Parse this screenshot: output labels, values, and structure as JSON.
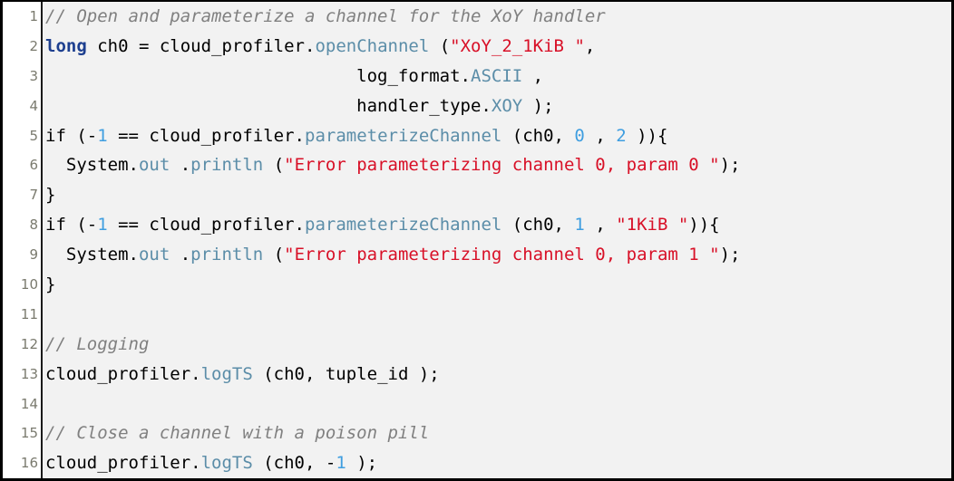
{
  "editor": {
    "kind": "code-listing",
    "language": "java",
    "background": "#f2f2f2",
    "gutter_background": "#ffffff",
    "border_color": "#000000",
    "line_number_color": "#7a7a6e",
    "colors": {
      "comment": "#808080",
      "keyword": "#1d3f8f",
      "method": "#5b8da8",
      "string": "#d81027",
      "number": "#3f9ee0",
      "plain": "#000000"
    },
    "line_numbers": [
      "1",
      "2",
      "3",
      "4",
      "5",
      "6",
      "7",
      "8",
      "9",
      "10",
      "11",
      "12",
      "13",
      "14",
      "15",
      "16"
    ],
    "lines": [
      {
        "number": "1",
        "text": "// Open and parameterize a channel for the XoY handler",
        "tokens": [
          {
            "t": "comment",
            "s": "// Open and parameterize a channel for the XoY handler"
          }
        ]
      },
      {
        "number": "2",
        "text": "long ch0 = cloud_profiler.openChannel (\"XoY_2_1KiB \",",
        "tokens": [
          {
            "t": "keyword",
            "s": "long"
          },
          {
            "t": "plain",
            "s": " ch0 = cloud_profiler."
          },
          {
            "t": "method",
            "s": "openChannel"
          },
          {
            "t": "plain",
            "s": " ("
          },
          {
            "t": "string",
            "s": "\"XoY_2_1KiB \""
          },
          {
            "t": "plain",
            "s": ","
          }
        ]
      },
      {
        "number": "3",
        "text": "                              log_format.ASCII ,",
        "tokens": [
          {
            "t": "plain",
            "s": "                              log_format."
          },
          {
            "t": "method",
            "s": "ASCII"
          },
          {
            "t": "plain",
            "s": " ,"
          }
        ]
      },
      {
        "number": "4",
        "text": "                              handler_type.XOY );",
        "tokens": [
          {
            "t": "plain",
            "s": "                              handler_type."
          },
          {
            "t": "method",
            "s": "XOY"
          },
          {
            "t": "plain",
            "s": " );"
          }
        ]
      },
      {
        "number": "5",
        "text": "if (-1 == cloud_profiler.parameterizeChannel (ch0, 0 , 2 )){",
        "tokens": [
          {
            "t": "plain",
            "s": "if (-"
          },
          {
            "t": "number",
            "s": "1"
          },
          {
            "t": "plain",
            "s": " == cloud_profiler."
          },
          {
            "t": "method",
            "s": "parameterizeChannel"
          },
          {
            "t": "plain",
            "s": " (ch0, "
          },
          {
            "t": "number",
            "s": "0"
          },
          {
            "t": "plain",
            "s": " , "
          },
          {
            "t": "number",
            "s": "2"
          },
          {
            "t": "plain",
            "s": " )){"
          }
        ]
      },
      {
        "number": "6",
        "text": "  System.out .println (\"Error parameterizing channel 0, param 0 \");",
        "tokens": [
          {
            "t": "plain",
            "s": "  System."
          },
          {
            "t": "method",
            "s": "out"
          },
          {
            "t": "plain",
            "s": " ."
          },
          {
            "t": "method",
            "s": "println"
          },
          {
            "t": "plain",
            "s": " ("
          },
          {
            "t": "string",
            "s": "\"Error parameterizing channel 0, param 0 \""
          },
          {
            "t": "plain",
            "s": ");"
          }
        ]
      },
      {
        "number": "7",
        "text": "}",
        "tokens": [
          {
            "t": "plain",
            "s": "}"
          }
        ]
      },
      {
        "number": "8",
        "text": "if (-1 == cloud_profiler.parameterizeChannel (ch0, 1 , \"1KiB \")){",
        "tokens": [
          {
            "t": "plain",
            "s": "if (-"
          },
          {
            "t": "number",
            "s": "1"
          },
          {
            "t": "plain",
            "s": " == cloud_profiler."
          },
          {
            "t": "method",
            "s": "parameterizeChannel"
          },
          {
            "t": "plain",
            "s": " (ch0, "
          },
          {
            "t": "number",
            "s": "1"
          },
          {
            "t": "plain",
            "s": " , "
          },
          {
            "t": "string",
            "s": "\"1KiB \""
          },
          {
            "t": "plain",
            "s": ")){"
          }
        ]
      },
      {
        "number": "9",
        "text": "  System.out .println (\"Error parameterizing channel 0, param 1 \");",
        "tokens": [
          {
            "t": "plain",
            "s": "  System."
          },
          {
            "t": "method",
            "s": "out"
          },
          {
            "t": "plain",
            "s": " ."
          },
          {
            "t": "method",
            "s": "println"
          },
          {
            "t": "plain",
            "s": " ("
          },
          {
            "t": "string",
            "s": "\"Error parameterizing channel 0, param 1 \""
          },
          {
            "t": "plain",
            "s": ");"
          }
        ]
      },
      {
        "number": "10",
        "text": "}",
        "tokens": [
          {
            "t": "plain",
            "s": "}"
          }
        ]
      },
      {
        "number": "11",
        "text": "",
        "tokens": []
      },
      {
        "number": "12",
        "text": "// Logging",
        "tokens": [
          {
            "t": "comment",
            "s": "// Logging"
          }
        ]
      },
      {
        "number": "13",
        "text": "cloud_profiler.logTS (ch0, tuple_id );",
        "tokens": [
          {
            "t": "plain",
            "s": "cloud_profiler."
          },
          {
            "t": "method",
            "s": "logTS"
          },
          {
            "t": "plain",
            "s": " (ch0, tuple_id );"
          }
        ]
      },
      {
        "number": "14",
        "text": "",
        "tokens": []
      },
      {
        "number": "15",
        "text": "// Close a channel with a poison pill",
        "tokens": [
          {
            "t": "comment",
            "s": "// Close a channel with a poison pill"
          }
        ]
      },
      {
        "number": "16",
        "text": "cloud_profiler.logTS (ch0, -1 );",
        "tokens": [
          {
            "t": "plain",
            "s": "cloud_profiler."
          },
          {
            "t": "method",
            "s": "logTS"
          },
          {
            "t": "plain",
            "s": " (ch0, -"
          },
          {
            "t": "number",
            "s": "1"
          },
          {
            "t": "plain",
            "s": " );"
          }
        ]
      }
    ]
  }
}
